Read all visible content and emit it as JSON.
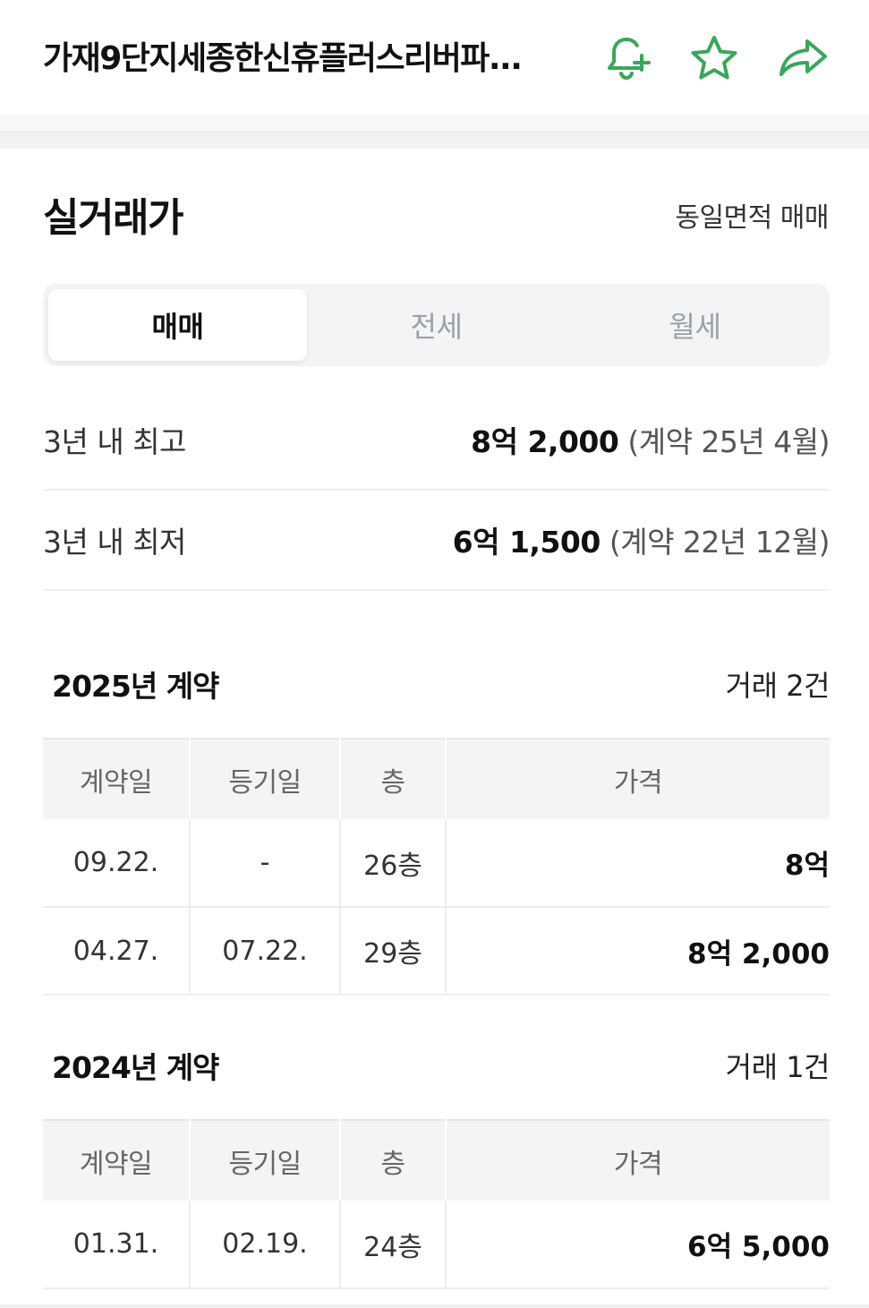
{
  "header": {
    "title": "가재9단지세종한신휴플러스리버파...",
    "icons": [
      "bell-plus-icon",
      "star-icon",
      "share-icon"
    ],
    "accent_color": "#3aa65a"
  },
  "section": {
    "title": "실거래가",
    "same_area_link": "동일면적 매매"
  },
  "tabs": [
    {
      "label": "매매",
      "active": true
    },
    {
      "label": "전세",
      "active": false
    },
    {
      "label": "월세",
      "active": false
    }
  ],
  "stats": {
    "high": {
      "label": "3년 내 최고",
      "price": "8억 2,000",
      "note": "(계약 25년 4월)"
    },
    "low": {
      "label": "3년 내 최저",
      "price": "6억 1,500",
      "note": "(계약 22년 12월)"
    }
  },
  "table_headers": [
    "계약일",
    "등기일",
    "층",
    "가격"
  ],
  "years": [
    {
      "title": "2025년 계약",
      "count": "거래 2건",
      "rows": [
        {
          "contract": "09.22.",
          "register": "-",
          "floor": "26층",
          "price": "8억"
        },
        {
          "contract": "04.27.",
          "register": "07.22.",
          "floor": "29층",
          "price": "8억 2,000"
        }
      ]
    },
    {
      "title": "2024년 계약",
      "count": "거래 1건",
      "rows": [
        {
          "contract": "01.31.",
          "register": "02.19.",
          "floor": "24층",
          "price": "6억 5,000"
        }
      ]
    }
  ]
}
